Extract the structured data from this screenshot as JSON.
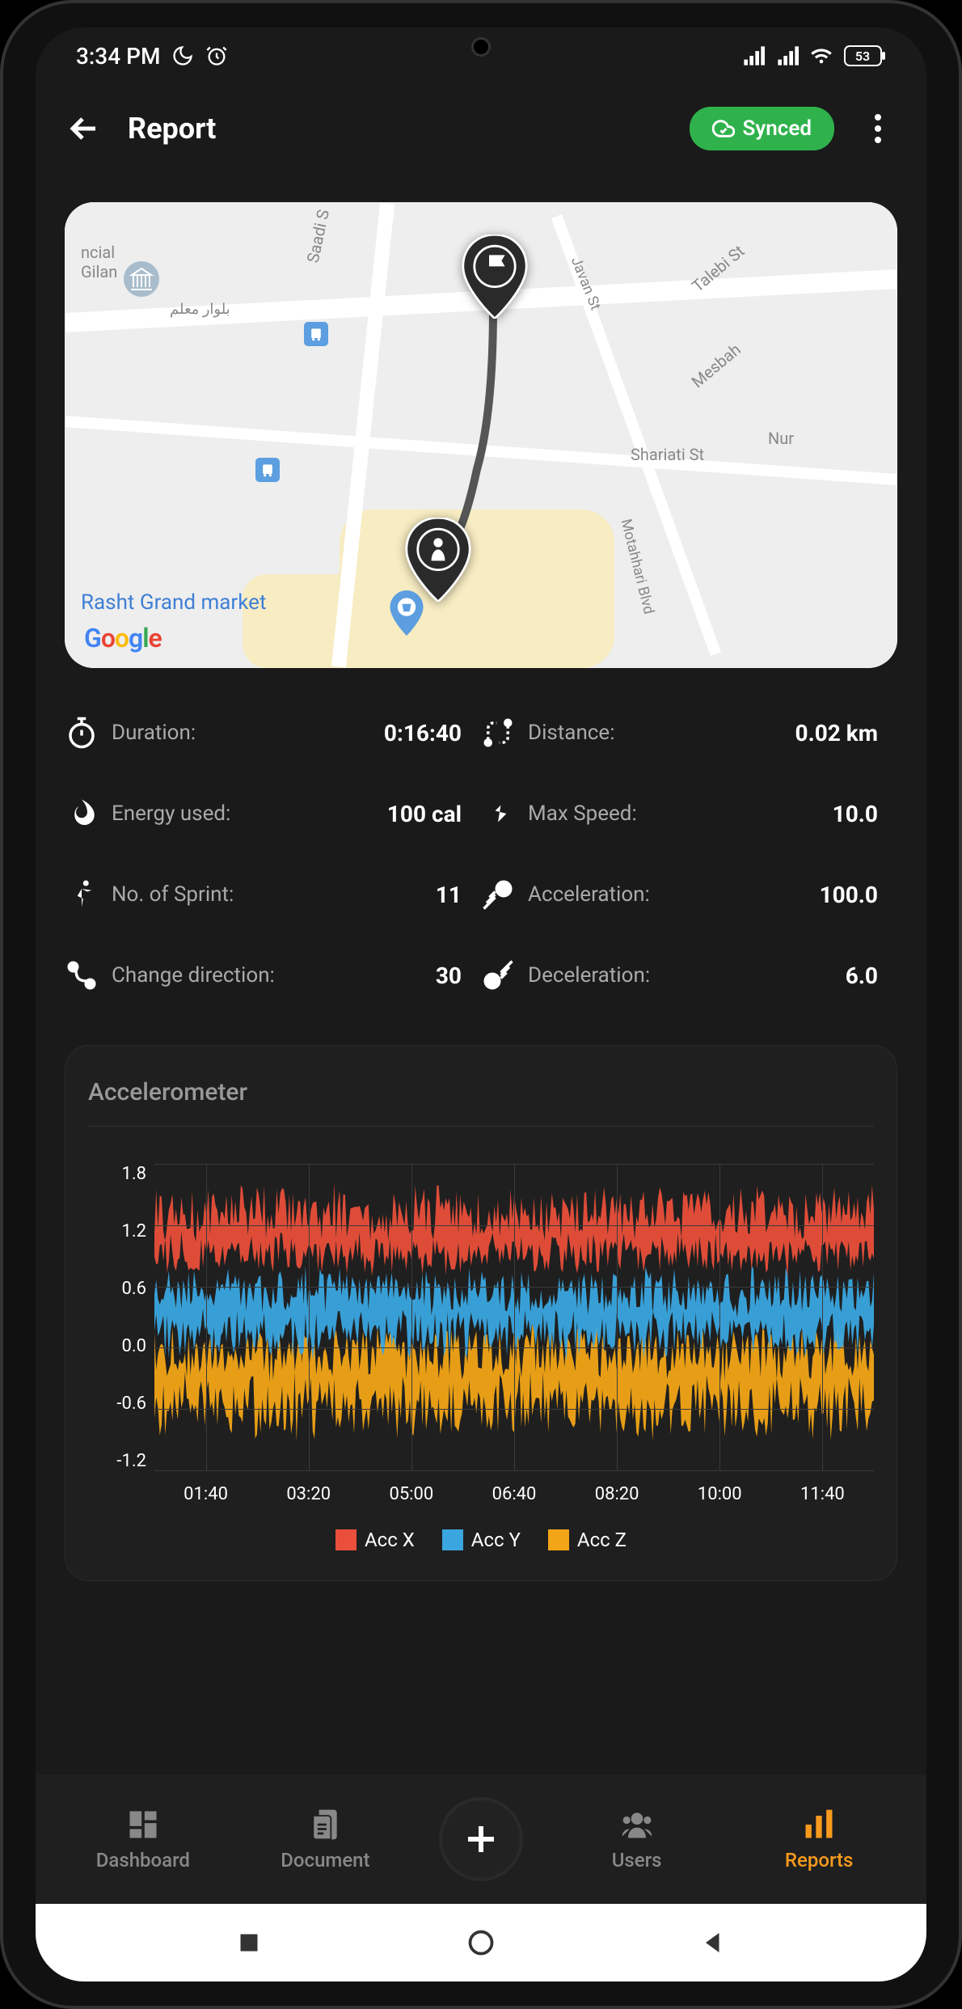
{
  "status_bar": {
    "time": "3:34 PM",
    "battery": "53"
  },
  "header": {
    "title": "Report",
    "sync_label": "Synced"
  },
  "map": {
    "label_gilan": "ncial\nGilan",
    "label_saadi": "Saadi S",
    "label_moallem": "بلوار معلم",
    "label_javan": "Javan St",
    "label_talebi": "Talebi St",
    "label_mesbah": "Mesbah",
    "label_shariati": "Shariati St",
    "label_nur": "Nur",
    "label_motahhari": "Motahhari Blvd",
    "label_market": "Rasht Grand market",
    "google": "Google"
  },
  "stats": {
    "duration_label": "Duration:",
    "duration_value": "0:16:40",
    "distance_label": "Distance:",
    "distance_value": "0.02 km",
    "energy_label": "Energy used:",
    "energy_value": "100 cal",
    "maxspeed_label": "Max Speed:",
    "maxspeed_value": "10.0",
    "sprint_label": "No. of Sprint:",
    "sprint_value": "11",
    "accel_label": "Acceleration:",
    "accel_value": "100.0",
    "dir_label": "Change direction:",
    "dir_value": "30",
    "decel_label": "Deceleration:",
    "decel_value": "6.0"
  },
  "chart_data": {
    "type": "line",
    "title": "Accelerometer",
    "y_ticks": [
      "1.8",
      "1.2",
      "0.6",
      "0.0",
      "-0.6",
      "-1.2"
    ],
    "x_ticks": [
      "01:40",
      "03:20",
      "05:00",
      "06:40",
      "08:20",
      "10:00",
      "11:40"
    ],
    "ylim": [
      -1.5,
      1.8
    ],
    "series": [
      {
        "name": "Acc X",
        "color": "#e94f3a",
        "mean": 1.0,
        "band": [
          0.6,
          1.6
        ]
      },
      {
        "name": "Acc Y",
        "color": "#3aa6e0",
        "mean": 0.2,
        "band": [
          -0.3,
          0.7
        ]
      },
      {
        "name": "Acc Z",
        "color": "#f2a516",
        "mean": -0.5,
        "band": [
          -1.2,
          0.1
        ]
      }
    ],
    "note": "Three dense noisy overlapping bands covering full time range; values estimated from visual envelope."
  },
  "nav": {
    "dashboard": "Dashboard",
    "document": "Document",
    "users": "Users",
    "reports": "Reports"
  }
}
